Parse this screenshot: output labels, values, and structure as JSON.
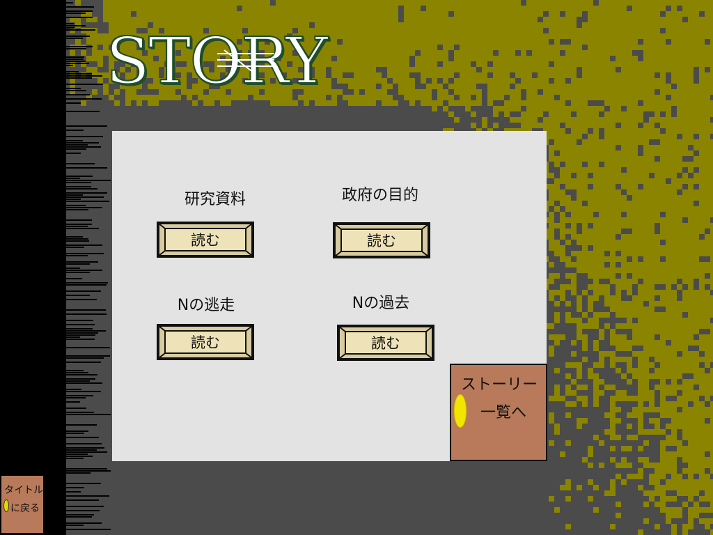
{
  "screen": {
    "title": "STORY",
    "colors": {
      "background": "#4b4b4b",
      "texture": "#8a8400",
      "left_strip": "#000000",
      "panel": "#e3e3e3",
      "button_face": "#d8cba0",
      "door": "#b87a5a",
      "door_knob": "#f2e600",
      "title_outline": "#1f4e2a"
    }
  },
  "stories": [
    {
      "label": "研究資料",
      "button_label": "読む"
    },
    {
      "label": "政府の目的",
      "button_label": "読む"
    },
    {
      "label": "Nの逃走",
      "button_label": "読む"
    },
    {
      "label": "Nの過去",
      "button_label": "読む"
    }
  ],
  "story_list_door": {
    "line1": "ストーリー",
    "line2": "一覧へ",
    "icon": "door-knob-icon"
  },
  "title_door": {
    "line1": "タイトル",
    "line2": "に戻る",
    "icon": "door-knob-icon"
  }
}
